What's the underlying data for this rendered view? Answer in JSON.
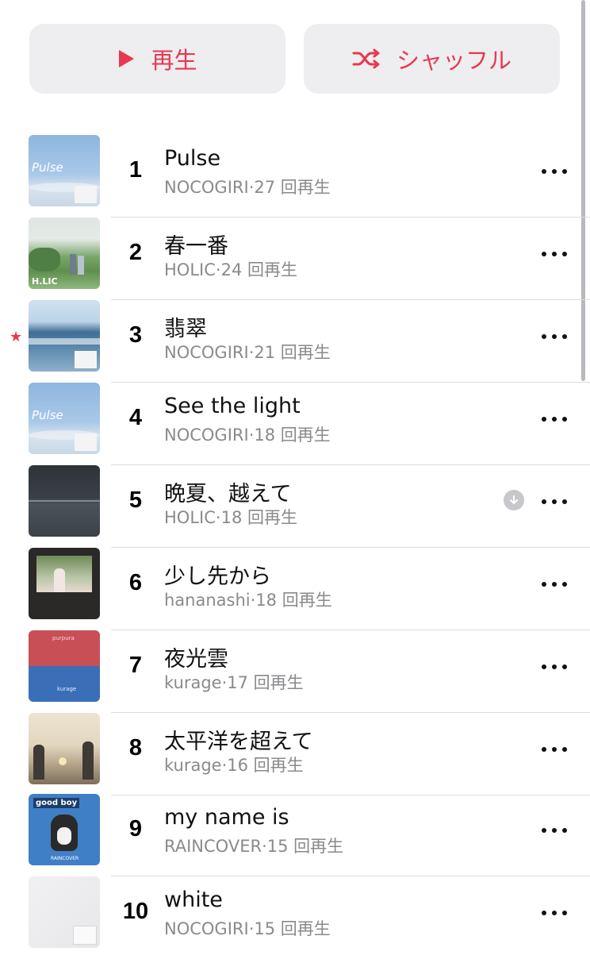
{
  "controls": {
    "play_label": "再生",
    "shuffle_label": "シャッフル",
    "accent_color": "#e8384f"
  },
  "tracks": [
    {
      "rank": "1",
      "title": "Pulse",
      "artist": "NOCOGIRI",
      "sep": "·",
      "plays": "27 回再生"
    },
    {
      "rank": "2",
      "title": "春一番",
      "artist": "HOLIC",
      "sep": "·",
      "plays": "24 回再生"
    },
    {
      "rank": "3",
      "title": "翡翠",
      "artist": "NOCOGIRI",
      "sep": "·",
      "plays": "21 回再生",
      "starred": true
    },
    {
      "rank": "4",
      "title": "See the light",
      "artist": "NOCOGIRI",
      "sep": "·",
      "plays": "18 回再生"
    },
    {
      "rank": "5",
      "title": "晩夏、越えて",
      "artist": "HOLIC",
      "sep": "·",
      "plays": "18 回再生",
      "downloaded": true
    },
    {
      "rank": "6",
      "title": "少し先から",
      "artist": "hananashi",
      "sep": "·",
      "plays": "18 回再生"
    },
    {
      "rank": "7",
      "title": "夜光雲",
      "artist": "kurage",
      "sep": "·",
      "plays": "17 回再生"
    },
    {
      "rank": "8",
      "title": "太平洋を超えて",
      "artist": "kurage",
      "sep": "·",
      "plays": "16 回再生"
    },
    {
      "rank": "9",
      "title": "my name is",
      "artist": "RAINCOVER",
      "sep": "·",
      "plays": "15 回再生"
    },
    {
      "rank": "10",
      "title": "white",
      "artist": "NOCOGIRI",
      "sep": "·",
      "plays": "15 回再生"
    }
  ],
  "artwork_text": {
    "pulse_logo": "Pulse",
    "holic_logo": "H.LIC",
    "purpura": "purpura",
    "kurage_logo": "kurage",
    "goodboy": "good boy",
    "raincover": "RAINCOVER"
  }
}
